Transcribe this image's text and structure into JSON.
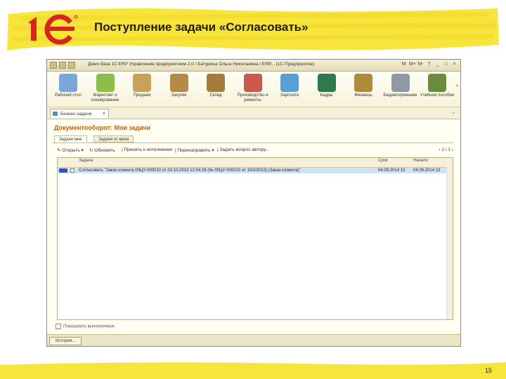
{
  "slide": {
    "title": "Поступление задачи «Согласовать»",
    "page_number": "15",
    "accent_color": "#f7e53b",
    "logo_color": "#d7261e"
  },
  "window": {
    "title": "Демо база 1С:ERP Управление предприятием 2.0 / Батурина Ольга Николаевна / ERP... (1С:Предприятие)",
    "controls": [
      "M",
      "M+",
      "M-",
      "?",
      "_",
      "□",
      "×"
    ]
  },
  "sections": [
    {
      "label": "Рабочий стол",
      "icon": "desk-icon",
      "color": "#7aa7d9"
    },
    {
      "label": "Маркетинг и планирование",
      "icon": "chart-pie-icon",
      "color": "#8cbf4a"
    },
    {
      "label": "Продажи",
      "icon": "truck-icon",
      "color": "#c9a25a"
    },
    {
      "label": "Закупки",
      "icon": "boxes-icon",
      "color": "#b58a48"
    },
    {
      "label": "Склад",
      "icon": "warehouse-icon",
      "color": "#a57b3e"
    },
    {
      "label": "Производство и ремонты",
      "icon": "factory-icon",
      "color": "#c9594a"
    },
    {
      "label": "Зарплата",
      "icon": "money-card-icon",
      "color": "#5a9fd4"
    },
    {
      "label": "Кадры",
      "icon": "book-icon",
      "color": "#2e7a4e"
    },
    {
      "label": "Финансы",
      "icon": "coins-icon",
      "color": "#b08b3a"
    },
    {
      "label": "Бюджетирование",
      "icon": "calculator-icon",
      "color": "#8f9aa6"
    },
    {
      "label": "Учебное пособие",
      "icon": "tutorial-icon",
      "color": "#6b8c3c"
    }
  ],
  "doc_tab": {
    "label": "Бизнес-задачи",
    "close": "×"
  },
  "form": {
    "title": "Документооборот: Мои задачи",
    "tabs": [
      "Задачи мне",
      "Задачи от меня"
    ],
    "commands": {
      "open": "Открыть ▾",
      "refresh": "Обновить",
      "accept": "Принять к исполнению",
      "redirect": "Перенаправить ▾",
      "ask": "Задать вопрос автору..."
    },
    "pager": "1 / 1",
    "columns": [
      "Задача",
      "Срок",
      "Начало"
    ],
    "rows": [
      {
        "task": "Согласовать \"Заказ клиента 00ЦУ-000010 от 02.10.2013 12:54:26 (№ 00ЦУ-000010 от 10/2/2013) (Заказ клиента)\"",
        "due": "04.09.2014 13",
        "start": "04.09.2014 13"
      }
    ],
    "checkbox_label": "Показывать выполненные",
    "history_button": "История..."
  }
}
